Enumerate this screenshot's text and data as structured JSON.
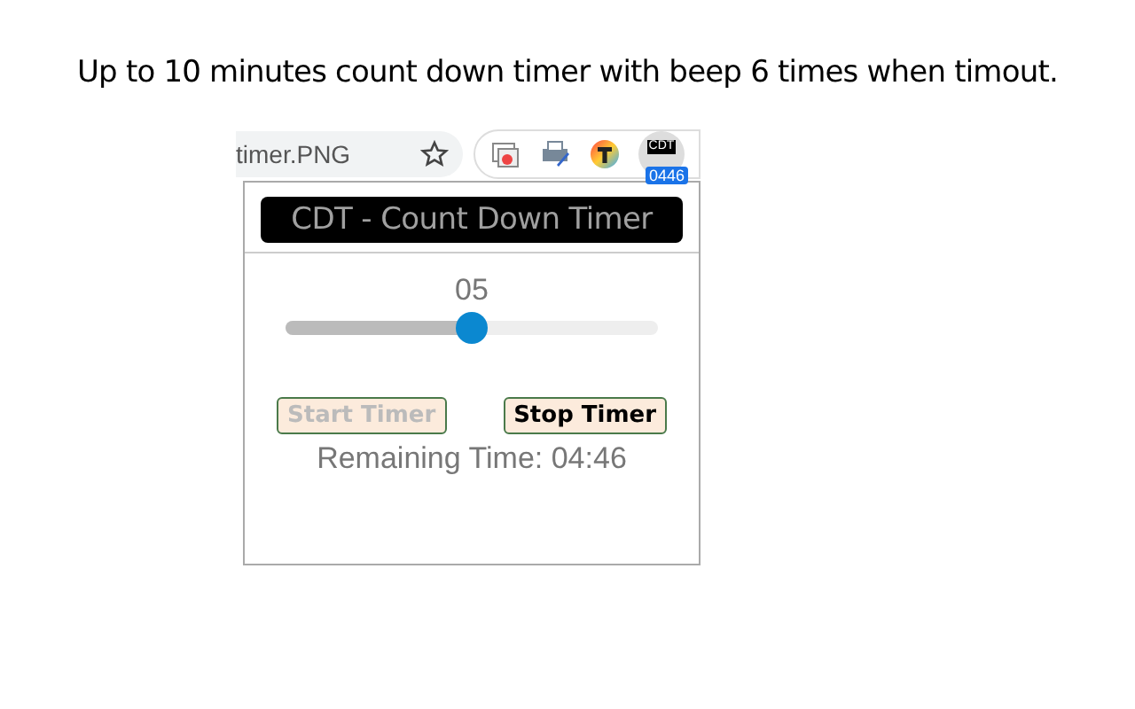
{
  "caption": "Up to 10 minutes count down timer with beep 6 times when timout.",
  "browser_toolbar": {
    "address": "timer.PNG",
    "extension_label": "CDT",
    "extension_badge": "0446"
  },
  "popup": {
    "title": "CDT - Count Down Timer",
    "minutes": "05",
    "slider": {
      "level": 0.5
    },
    "buttons": [
      {
        "label": "Start Timer",
        "disabled": true
      },
      {
        "label": "Stop Timer",
        "disabled": false
      }
    ],
    "remaining": "Remaining Time: 04:46"
  }
}
